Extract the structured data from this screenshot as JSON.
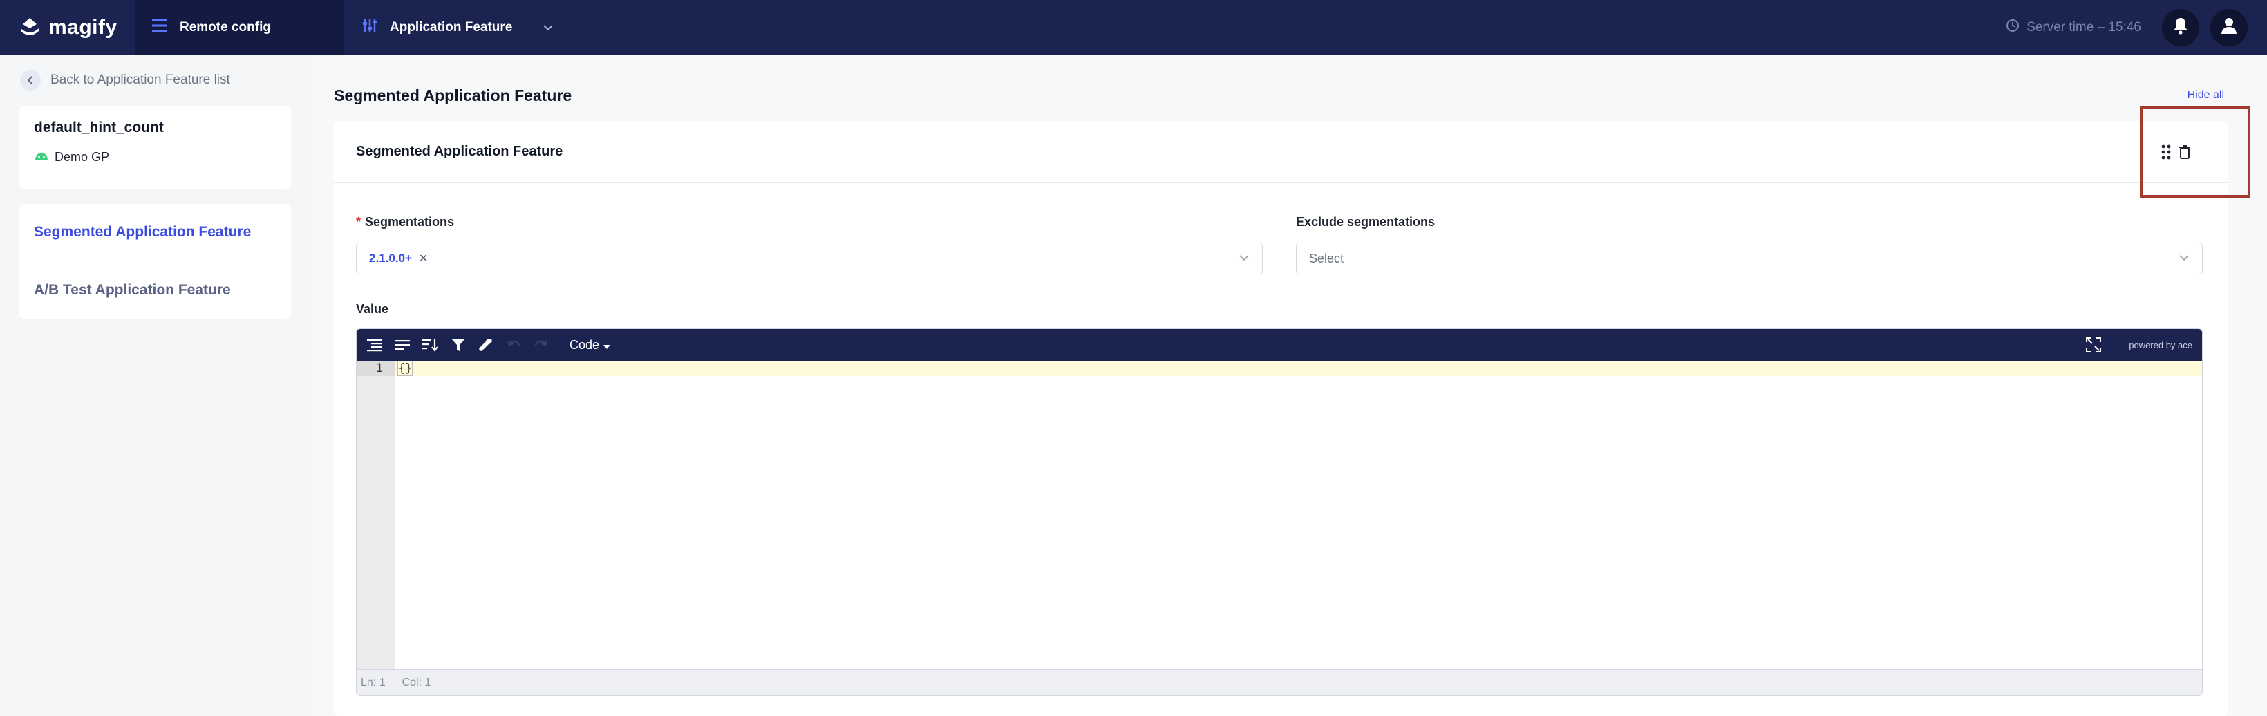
{
  "topbar": {
    "brand": "magify",
    "nav_remote": "Remote config",
    "nav_feature": "Application Feature",
    "server_time": "Server time – 15:46"
  },
  "sidebar": {
    "back_link": "Back to Application Feature list",
    "info_title": "default_hint_count",
    "info_app": "Demo GP",
    "items": [
      {
        "label": "Segmented Application Feature"
      },
      {
        "label": "A/B Test Application Feature"
      }
    ]
  },
  "main": {
    "title": "Segmented Application Feature",
    "hide_all": "Hide all",
    "panel_title": "Segmented Application Feature",
    "segmentations_label": "Segmentations",
    "segmentation_tag": "2.1.0.0+",
    "exclude_label": "Exclude segmentations",
    "exclude_placeholder": "Select",
    "value_label": "Value"
  },
  "editor": {
    "mode": "Code",
    "powered": "powered by ace",
    "line_number": "1",
    "content": "{}",
    "status_ln": "Ln: 1",
    "status_col": "Col: 1"
  },
  "colors": {
    "topbar": "#1b2350",
    "accent": "#3b4ce0",
    "highlight": "#a63a2c"
  }
}
